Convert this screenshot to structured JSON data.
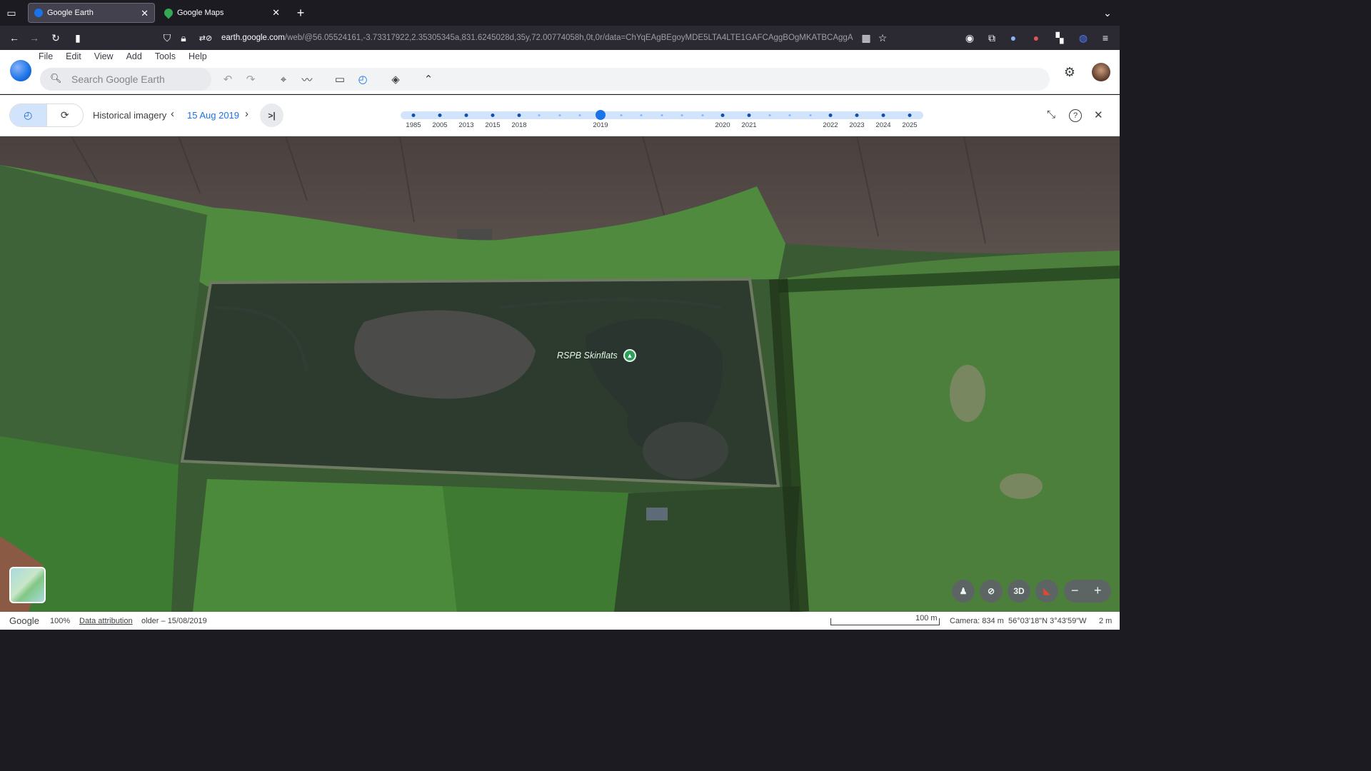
{
  "browser": {
    "tabs": [
      {
        "title": "Google Earth",
        "active": true
      },
      {
        "title": "Google Maps",
        "active": false
      }
    ],
    "url_host": "earth.google.com",
    "url_path": "/web/@56.05524161,-3.73317922,2.35305345a,831.6245028d,35y,72.00774058h,0t,0r/data=ChYqEAgBEgoyMDE5LTA4LTE1GAFCAggBOgMKATBCAggA"
  },
  "app": {
    "menu": [
      "File",
      "Edit",
      "View",
      "Add",
      "Tools",
      "Help"
    ],
    "search": {
      "placeholder": "Search Google Earth"
    }
  },
  "historical": {
    "label": "Historical imagery",
    "date": "15 Aug 2019",
    "years": [
      "1985",
      "2005",
      "2013",
      "2015",
      "2018",
      "2019",
      "2020",
      "2021",
      "2022",
      "2023",
      "2024",
      "2025"
    ],
    "selected_year": "2019"
  },
  "map": {
    "place_label": "RSPB Skinflats",
    "button_3d": "3D"
  },
  "status": {
    "google": "Google",
    "zoom": "100%",
    "attribution": "Data attribution",
    "imagery_date": "older – 15/08/2019",
    "scale": "100 m",
    "camera": "Camera: 834 m",
    "coords": "56°03'18\"N 3°43'59\"W",
    "elevation": "2 m"
  },
  "colors": {
    "accent": "#1a73e8",
    "toolbar_bg": "#ffffff",
    "browser_bg": "#1c1b22"
  }
}
